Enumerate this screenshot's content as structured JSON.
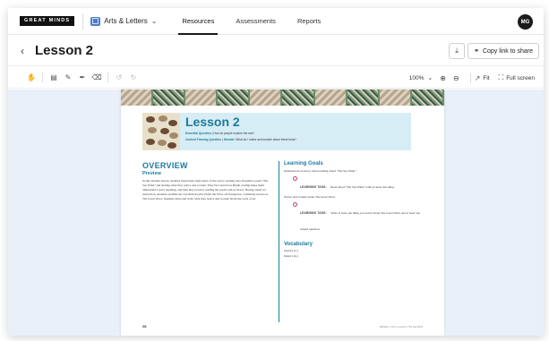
{
  "brand": {
    "logo_text": "GREAT MINDS"
  },
  "nav": {
    "subject_label": "Arts & Letters",
    "tabs": [
      {
        "label": "Resources",
        "active": true
      },
      {
        "label": "Assessments",
        "active": false
      },
      {
        "label": "Reports",
        "active": false
      }
    ],
    "avatar_initials": "MG"
  },
  "header": {
    "back_icon": "chevron-left-icon",
    "title": "Lesson 2",
    "copy_link_label": "Copy link to share"
  },
  "toolbar": {
    "zoom": "100%",
    "fit_label": "Fit",
    "full_screen_label": "Full screen"
  },
  "document": {
    "lesson_title": "Lesson 2",
    "essential_question_label": "Essential Question",
    "essential_question": "How do people explore the sea?",
    "focusing_question_label": "Content Framing Question",
    "focusing_question_sub": "Wonder",
    "focusing_question": "What do I notice and wonder about these texts?",
    "overview_heading": "OVERVIEW",
    "preview_heading": "Preview",
    "preview_text": "In this Wonder lesson, students begin their exploration of the sea by reading Sara Teasdale's poem \"The Sea Wind\" and sharing what they notice and wonder. They first learn how Bunin reading helps them understand a text's meaning, and then they practice reading the poem with accuracy. During visual art instruction, students examine the woodblock print Under the Wave off Kanagawa, commonly known as The Great Wave. Students share and write what they notice and wonder about the work of art.",
    "goals_heading": "Learning Goals",
    "goal_1": "Demonstrate accuracy when reading aloud \"The Sea Wind.\"",
    "task_label": "LEARNING TASK:",
    "task_1_text": "Read aloud \"The Sea Wind\" with accurate decoding.",
    "goal_2": "Notice and wonder about The Great Wave.",
    "task_2_text": "Write at least one thing you notice about The Great Wave and at least one related question.",
    "vocab_heading": "Vocabulary",
    "vocab": [
      "explore (v.)",
      "fluency (n.)"
    ],
    "page_number": "28",
    "footer": "REVEAL 1  Unit 1  Lesson 2  The Sea Wind"
  },
  "colors": {
    "accent_teal": "#1d7a9c",
    "viewer_bg": "#eaf0fa",
    "info_bg": "#d7edf5",
    "subject_icon": "#4f7cc9"
  }
}
